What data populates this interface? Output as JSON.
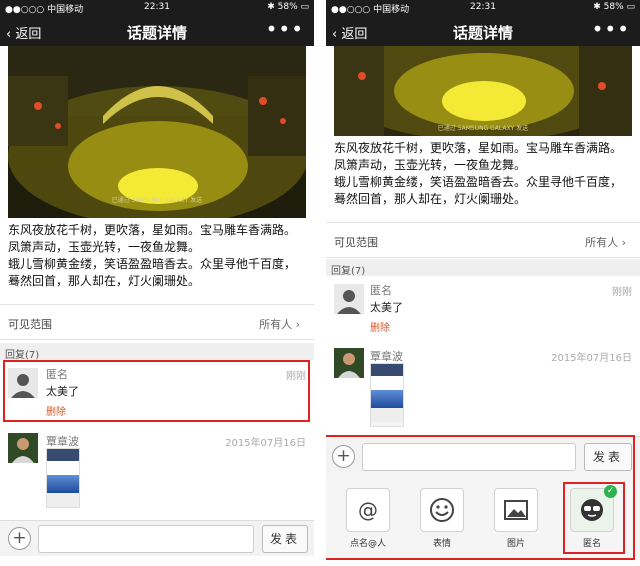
{
  "status_bar": {
    "carrier": "●●○○○ 中国移动",
    "time": "22:31",
    "battery": "✱ 58% ▭"
  },
  "nav": {
    "back_label": "返回",
    "title": "话题详情",
    "more_label": "•••"
  },
  "post": {
    "watermark": "已通过 SAMSUNG GALAXY 发送",
    "poem_lines": [
      "东风夜放花千树，更吹落，星如雨。宝马雕车香满路。",
      "凤箫声动，玉壶光转，一夜鱼龙舞。",
      "蛾儿雪柳黄金缕，笑语盈盈暗香去。众里寻他千百度，",
      "蓦然回首，那人却在，灯火阑珊处。"
    ]
  },
  "visibility": {
    "label": "可见范围",
    "value": "所有人 ›"
  },
  "replies": {
    "header": "回复(7)",
    "items": [
      {
        "name": "匿名",
        "time": "刚刚",
        "text": "太美了",
        "delete_label": "删除"
      },
      {
        "name": "覃章波",
        "time": "2015年07月16日"
      }
    ]
  },
  "composer": {
    "plus_label": "+",
    "input_value": "",
    "send_label": "发表"
  },
  "tools": [
    {
      "label": "点名@人",
      "icon": "at-icon"
    },
    {
      "label": "表情",
      "icon": "emoji-icon"
    },
    {
      "label": "图片",
      "icon": "image-icon"
    },
    {
      "label": "匿名",
      "icon": "anonymous-mask-icon",
      "selected": true
    }
  ],
  "colors": {
    "highlight": "#dd2222",
    "delete": "#d75b2a",
    "selected_check": "#2fb14c"
  }
}
